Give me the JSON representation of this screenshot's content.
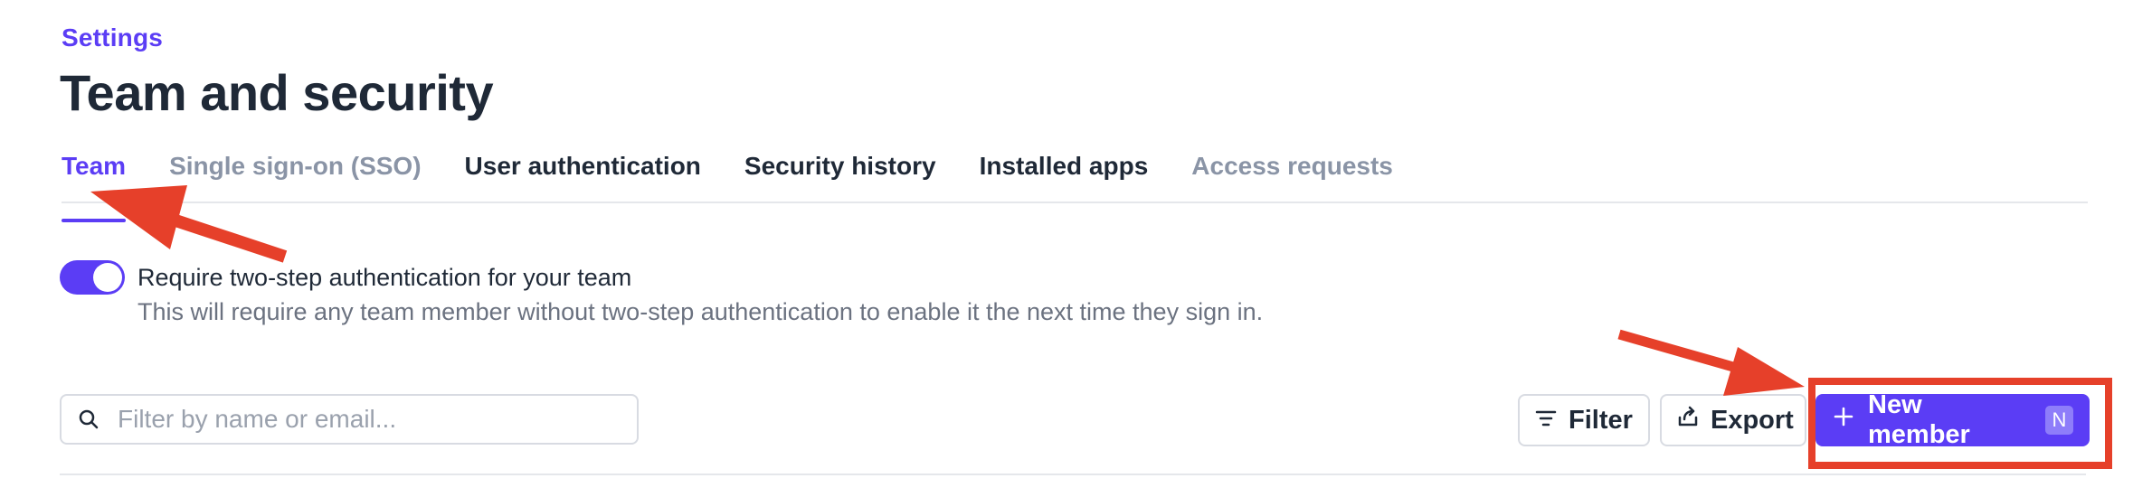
{
  "breadcrumb": "Settings",
  "title": "Team and security",
  "tabs": [
    {
      "label": "Team",
      "state": "active"
    },
    {
      "label": "Single sign-on (SSO)",
      "state": "muted"
    },
    {
      "label": "User authentication",
      "state": "normal"
    },
    {
      "label": "Security history",
      "state": "normal"
    },
    {
      "label": "Installed apps",
      "state": "normal"
    },
    {
      "label": "Access requests",
      "state": "muted"
    }
  ],
  "two_step": {
    "enabled": true,
    "title": "Require two-step authentication for your team",
    "description": "This will require any team member without two-step authentication to enable it the next time they sign in."
  },
  "search": {
    "placeholder": "Filter by name or email...",
    "icon": "search-icon"
  },
  "toolbar": {
    "filter_label": "Filter",
    "filter_icon": "filter-lines-icon",
    "export_label": "Export",
    "export_icon": "export-icon",
    "new_member_label": "New member",
    "new_member_icon": "plus-icon",
    "new_member_shortcut": "N"
  },
  "colors": {
    "accent": "#5b3df5",
    "annotation": "#e6402a",
    "text": "#1f2937",
    "muted": "#8a94a6"
  }
}
